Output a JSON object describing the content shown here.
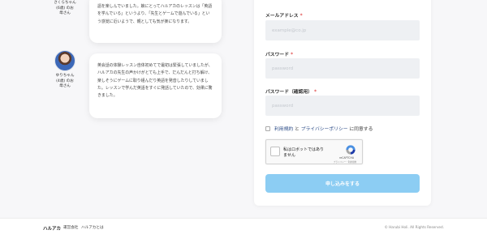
{
  "testimonials": [
    {
      "name": "さくらちゃん\n(6歳) のお\n母さん",
      "text": "語を楽しんでいました。娘にとってハルアカのレッスンは「英語を学んでいる」というより、「先生とゲームで遊んでいる」という感覚に近いようで、親としても気が楽になります。"
    },
    {
      "name": "ゆりちゃん\n(4歳) のお\n母さん",
      "text": "英会話の体験レッスン自体初めてで最初は緊張していましたが、ハルアカの先生の声かけがとても上手で、だんだんと打ち解け、楽しそうにゲームに取り組んだり英語を発音したりしていました。レッスンで学んだ英語をすぐに発話していたので、効果に驚きました。"
    }
  ],
  "form": {
    "email_label": "メールアドレス",
    "email_placeholder": "example@co.jp",
    "password_label": "パスワード",
    "password_placeholder": "password",
    "confirm_label": "パスワード（確認用）",
    "confirm_placeholder": "password",
    "required_mark": "*",
    "agree_terms": "利用規約",
    "agree_and": " と ",
    "agree_privacy": "プライバシーポリシー",
    "agree_suffix": " に同意する",
    "submit_label": "申し込みをする"
  },
  "captcha": {
    "label": "私はロボットではありません",
    "brand": "reCAPTCHA",
    "terms": "プライバシー・利用規約"
  },
  "footer": {
    "logo": "ハルアカ",
    "company": "運営会社",
    "about": "ハルアカとは",
    "copyright": "© Harubi Holi. All Rights Reserved."
  }
}
